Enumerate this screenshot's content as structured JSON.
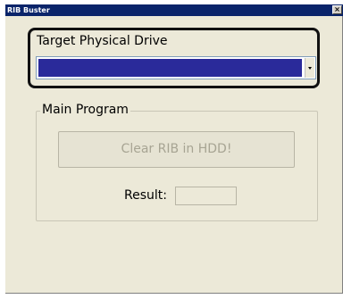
{
  "window": {
    "title": "RIB Buster",
    "close_glyph": "×"
  },
  "drive": {
    "group_label": "Target Physical Drive",
    "selected_value": "",
    "highlight_color": "#2a2a9a"
  },
  "main_program": {
    "group_label": "Main Program",
    "clear_button_label": "Clear RIB in HDD!",
    "clear_button_enabled": false,
    "result_label": "Result:",
    "result_value": ""
  },
  "icons": {
    "close": "close-icon",
    "dropdown": "chevron-down-icon"
  },
  "colors": {
    "titlebar": "#0a246a",
    "window_bg": "#ece9d8",
    "disabled_text": "#a7a493"
  }
}
